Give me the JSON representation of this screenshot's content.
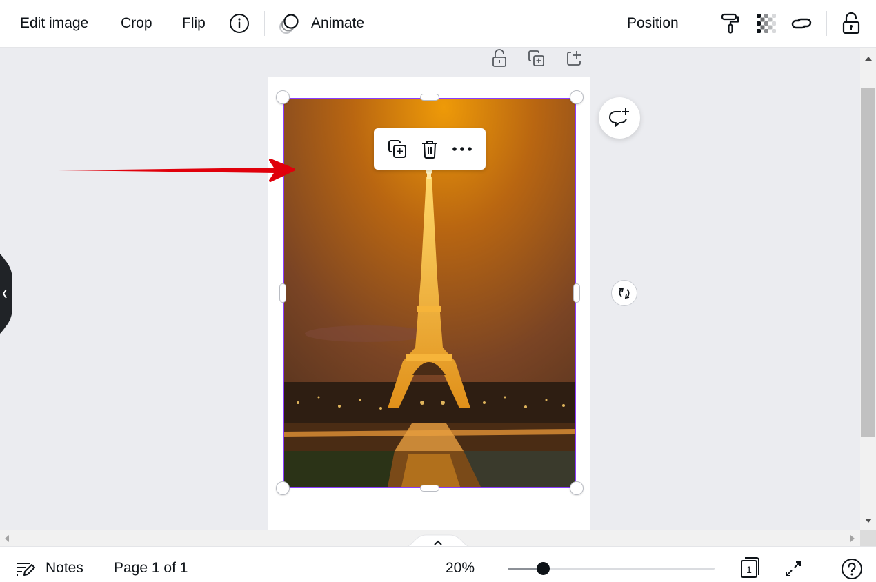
{
  "toolbar": {
    "edit_image": "Edit image",
    "crop": "Crop",
    "flip": "Flip",
    "info_icon": "info-icon",
    "animate_icon": "animate-icon",
    "animate": "Animate",
    "position": "Position",
    "right_icons": [
      "paint-roller-icon",
      "transparency-icon",
      "link-icon",
      "unlock-icon"
    ]
  },
  "page_actions": [
    "unlock-icon",
    "duplicate-page-icon",
    "add-page-icon"
  ],
  "selection": {
    "context_menu": [
      "duplicate-icon",
      "trash-icon",
      "more-icon"
    ],
    "border_color": "#8b3dff"
  },
  "canvas": {
    "comment_icon": "add-comment-icon",
    "rotate_icon": "rotate-icon",
    "side_panel_toggle": "chevron-left-icon",
    "annotation_arrow_color": "#e0000b"
  },
  "bottombar": {
    "notes": "Notes",
    "page_indicator": "Page 1 of 1",
    "zoom_label": "20%",
    "zoom_fraction": 0.17,
    "page_count": "1",
    "fullscreen_icon": "expand-icon",
    "help_icon": "help-icon"
  },
  "scrollbars": {
    "vertical_thumb_start": 0.08,
    "vertical_thumb_fraction": 0.73
  }
}
